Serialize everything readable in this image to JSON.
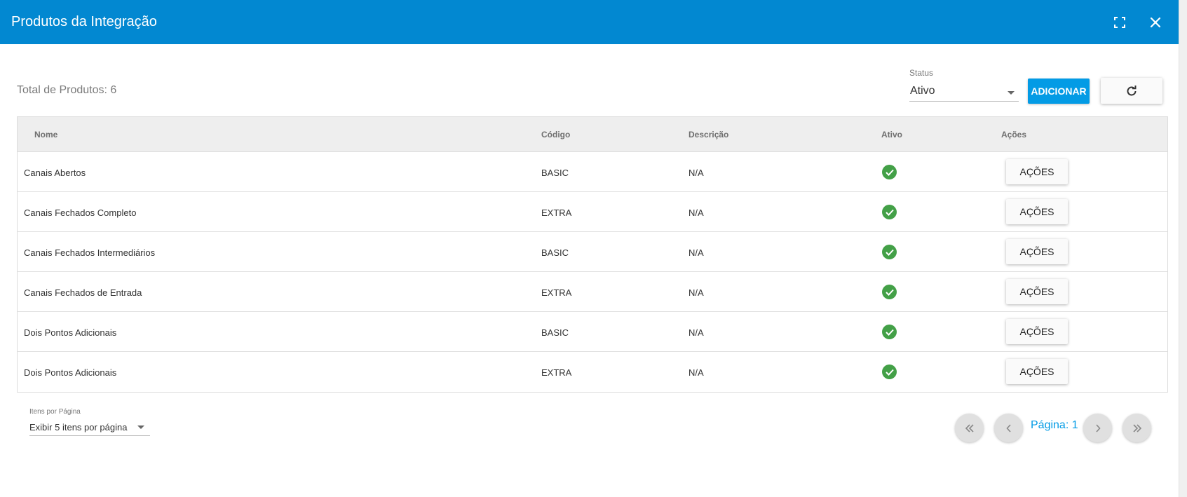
{
  "header": {
    "title": "Produtos da Integração",
    "fullscreen_icon": "fullscreen-icon",
    "close_icon": "close-icon",
    "bg_color": "#0288d1"
  },
  "toolbar": {
    "total_label": "Total de Produtos: 6",
    "status_label": "Status",
    "status_value": "Ativo",
    "add_label": "ADICIONAR",
    "refresh_icon": "refresh-icon"
  },
  "table": {
    "columns": [
      "Nome",
      "Código",
      "Descrição",
      "Ativo",
      "Ações"
    ],
    "rows": [
      {
        "nome": "Canais Abertos",
        "codigo": "BASIC",
        "descricao": "N/A",
        "ativo": true,
        "acoes": "AÇÕES"
      },
      {
        "nome": "Canais Fechados Completo",
        "codigo": "EXTRA",
        "descricao": "N/A",
        "ativo": true,
        "acoes": "AÇÕES"
      },
      {
        "nome": "Canais Fechados Intermediários",
        "codigo": "BASIC",
        "descricao": "N/A",
        "ativo": true,
        "acoes": "AÇÕES"
      },
      {
        "nome": "Canais Fechados de Entrada",
        "codigo": "EXTRA",
        "descricao": "N/A",
        "ativo": true,
        "acoes": "AÇÕES"
      },
      {
        "nome": "Dois Pontos Adicionais",
        "codigo": "BASIC",
        "descricao": "N/A",
        "ativo": true,
        "acoes": "AÇÕES"
      },
      {
        "nome": "Dois Pontos Adicionais",
        "codigo": "EXTRA",
        "descricao": "N/A",
        "ativo": true,
        "acoes": "AÇÕES"
      }
    ],
    "active_color": "#43a047"
  },
  "pagination": {
    "items_per_page_label": "Itens por Página",
    "items_per_page_value": "Exibir 5 itens por página",
    "page_label": "Página: 1",
    "accent_color": "#039be5"
  }
}
